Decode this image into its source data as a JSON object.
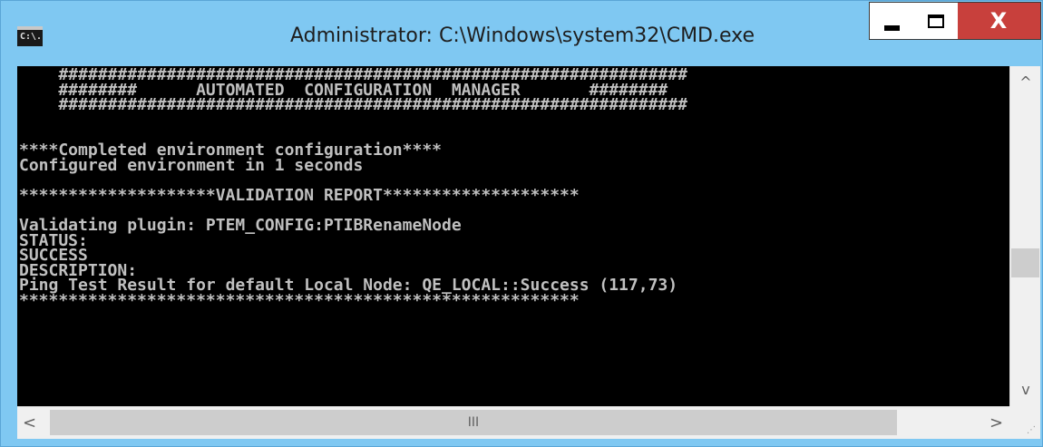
{
  "window": {
    "title": "Administrator: C:\\Windows\\system32\\CMD.exe",
    "app_icon_text": "C:\\.",
    "controls": {
      "close_glyph": "X"
    }
  },
  "console": {
    "lines": [
      "    ################################################################",
      "    ########      AUTOMATED  CONFIGURATION  MANAGER       ########",
      "    ################################################################",
      "",
      "",
      "****Completed environment configuration****",
      "Configured environment in 1 seconds",
      "",
      "********************VALIDATION REPORT********************",
      "",
      "Validating plugin: PTEM_CONFIG:PTIBRenameNode",
      "STATUS:",
      "SUCCESS",
      "DESCRIPTION:",
      "Ping Test Result for default Local Node: QE_LOCAL::Success (117,73)",
      "*********************************************************"
    ]
  },
  "scrollbars": {
    "vertical": {
      "up_glyph": "^",
      "down_glyph": "v"
    },
    "horizontal": {
      "left_glyph": "<",
      "right_glyph": ">",
      "grip_glyph": "III"
    }
  },
  "colors": {
    "titlebar": "#7fc8f2",
    "console_bg": "#000000",
    "console_fg": "#c0c0c0",
    "close_button": "#c8403c"
  }
}
